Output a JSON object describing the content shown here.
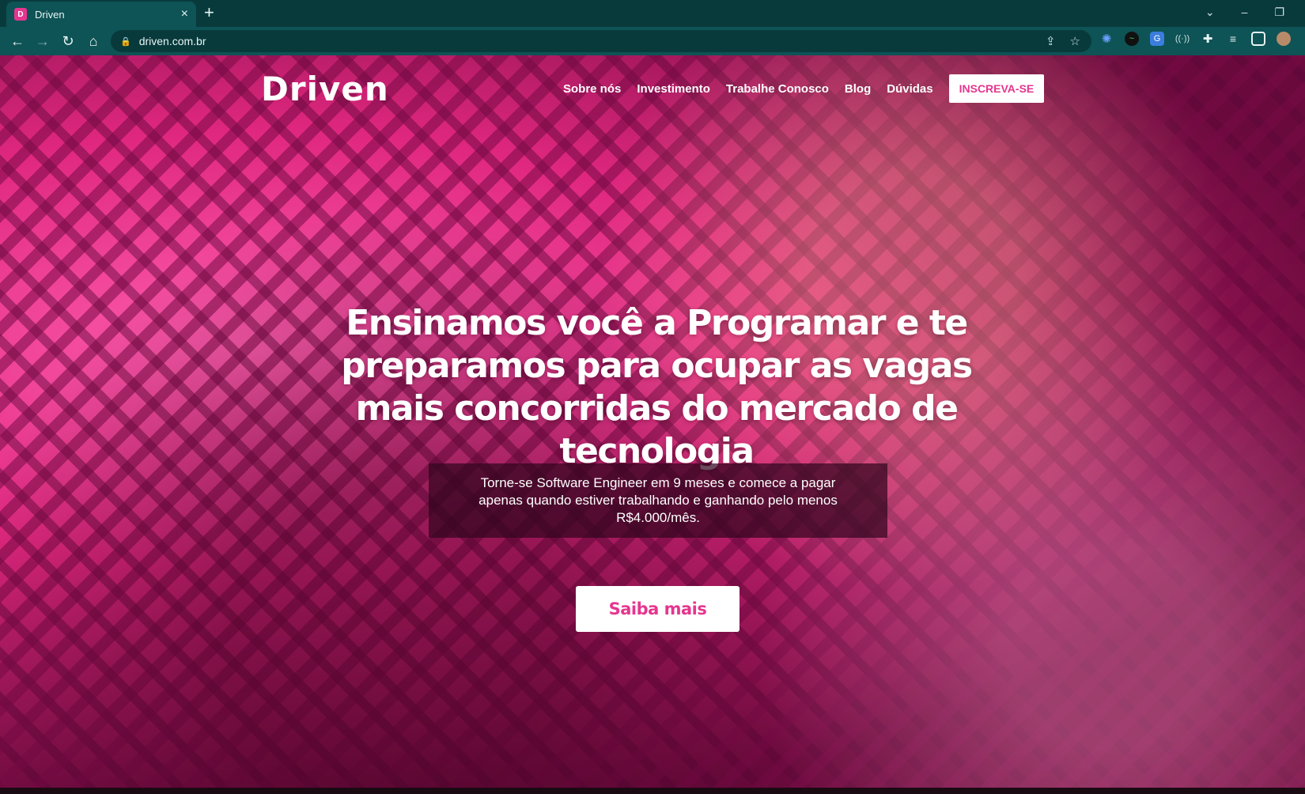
{
  "browser": {
    "tab_title": "Driven",
    "tab_close": "×",
    "new_tab": "+",
    "url": "driven.com.br",
    "win": {
      "dropdown": "⌄",
      "minimize": "–",
      "restore": "❐"
    }
  },
  "site": {
    "logo": "Driven",
    "nav": [
      "Sobre nós",
      "Investimento",
      "Trabalhe Conosco",
      "Blog",
      "Dúvidas"
    ],
    "cta_top": "INSCREVA-SE",
    "hero_title": "Ensinamos você a Programar e te preparamos para ocupar as vagas mais concorridas do mercado de tecnologia",
    "hero_subtitle": "Torne-se Software Engineer em 9 meses e comece a pagar apenas quando estiver trabalhando e ganhando pelo menos R$4.000/mês.",
    "hero_button": "Saiba mais"
  },
  "colors": {
    "brand_pink": "#e6358f",
    "chrome_dark": "#083a3c",
    "chrome_toolbar": "#0e5356"
  }
}
